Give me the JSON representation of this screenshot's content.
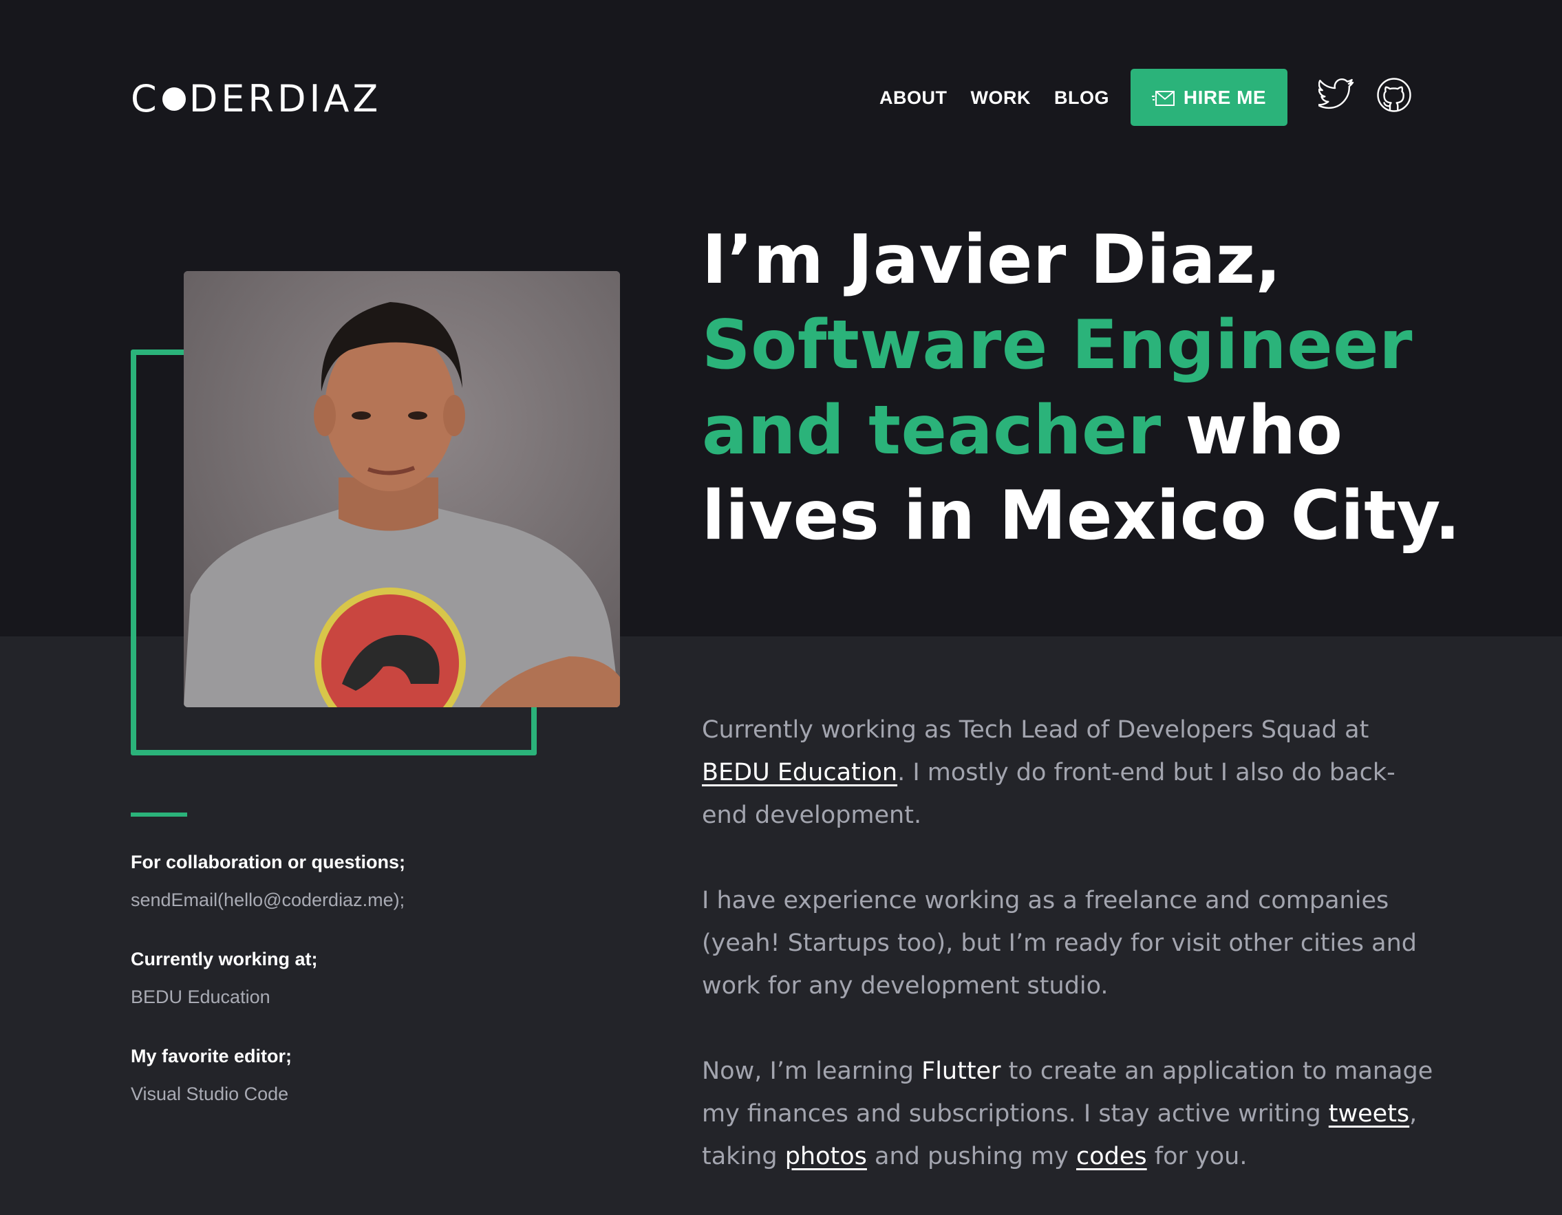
{
  "brand": {
    "logo_prefix": "C",
    "logo_suffix": "DERDIAZ",
    "accent_color": "#2bb37a"
  },
  "nav": {
    "about": "ABOUT",
    "work": "WORK",
    "blog": "BLOG",
    "hire_me": "HIRE ME"
  },
  "hero": {
    "line1": "I’m Javier Diaz,",
    "line2": "Software Engineer",
    "line3_green": "and teacher",
    "line3_white": " who",
    "line4": "lives in Mexico City."
  },
  "info": {
    "collab_label": "For collaboration or questions;",
    "collab_value": "sendEmail(hello@coderdiaz.me);",
    "work_label": "Currently working at;",
    "work_value": "BEDU Education",
    "editor_label": "My favorite editor;",
    "editor_value": "Visual Studio Code"
  },
  "bio": {
    "p1_a": "Currently working as Tech Lead of Developers Squad at ",
    "p1_link": "BEDU Education",
    "p1_b": ". I mostly do front-end but I also do back-end development.",
    "p2": "I have experience working as a freelance and companies (yeah! Startups too), but I’m ready for visit other cities and work for any development studio.",
    "p3_a": "Now, I’m learning ",
    "p3_flutter": "Flutter",
    "p3_b": " to create an application to manage my finances and subscriptions. I stay active writing ",
    "p3_tweets": "tweets",
    "p3_c": ", taking ",
    "p3_photos": "photos",
    "p3_d": " and pushing my ",
    "p3_codes": "codes",
    "p3_e": " for you."
  },
  "icons": {
    "twitter": "twitter-icon",
    "github": "github-icon",
    "mail": "mail-icon"
  }
}
